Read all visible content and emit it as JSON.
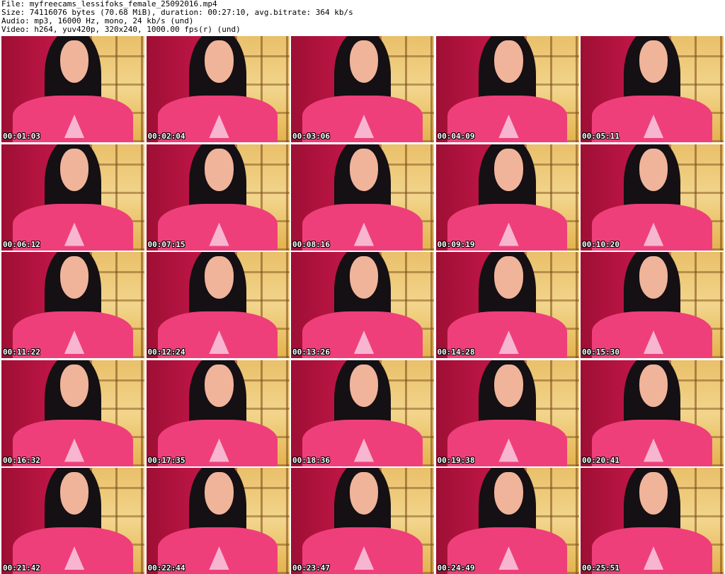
{
  "header": {
    "file_line": "File: myfreecams_lessifoks_female_25092016.mp4",
    "size_line": "Size: 74116076 bytes (70.68 MiB), duration: 00:27:10, avg.bitrate: 364 kb/s",
    "audio_line": "Audio: mp3, 16000 Hz, mono, 24 kb/s (und)",
    "video_line": "Video: h264, yuv420p, 320x240, 1000.00 fps(r) (und)"
  },
  "thumbnails": [
    {
      "timestamp": "00:01:03"
    },
    {
      "timestamp": "00:02:04"
    },
    {
      "timestamp": "00:03:06"
    },
    {
      "timestamp": "00:04:09"
    },
    {
      "timestamp": "00:05:11"
    },
    {
      "timestamp": "00:06:12"
    },
    {
      "timestamp": "00:07:15"
    },
    {
      "timestamp": "00:08:16"
    },
    {
      "timestamp": "00:09:19"
    },
    {
      "timestamp": "00:10:20"
    },
    {
      "timestamp": "00:11:22"
    },
    {
      "timestamp": "00:12:24"
    },
    {
      "timestamp": "00:13:26"
    },
    {
      "timestamp": "00:14:28"
    },
    {
      "timestamp": "00:15:30"
    },
    {
      "timestamp": "00:16:32"
    },
    {
      "timestamp": "00:17:35"
    },
    {
      "timestamp": "00:18:36"
    },
    {
      "timestamp": "00:19:38"
    },
    {
      "timestamp": "00:20:41"
    },
    {
      "timestamp": "00:21:42"
    },
    {
      "timestamp": "00:22:44"
    },
    {
      "timestamp": "00:23:47"
    },
    {
      "timestamp": "00:24:49"
    },
    {
      "timestamp": "00:25:51"
    }
  ]
}
